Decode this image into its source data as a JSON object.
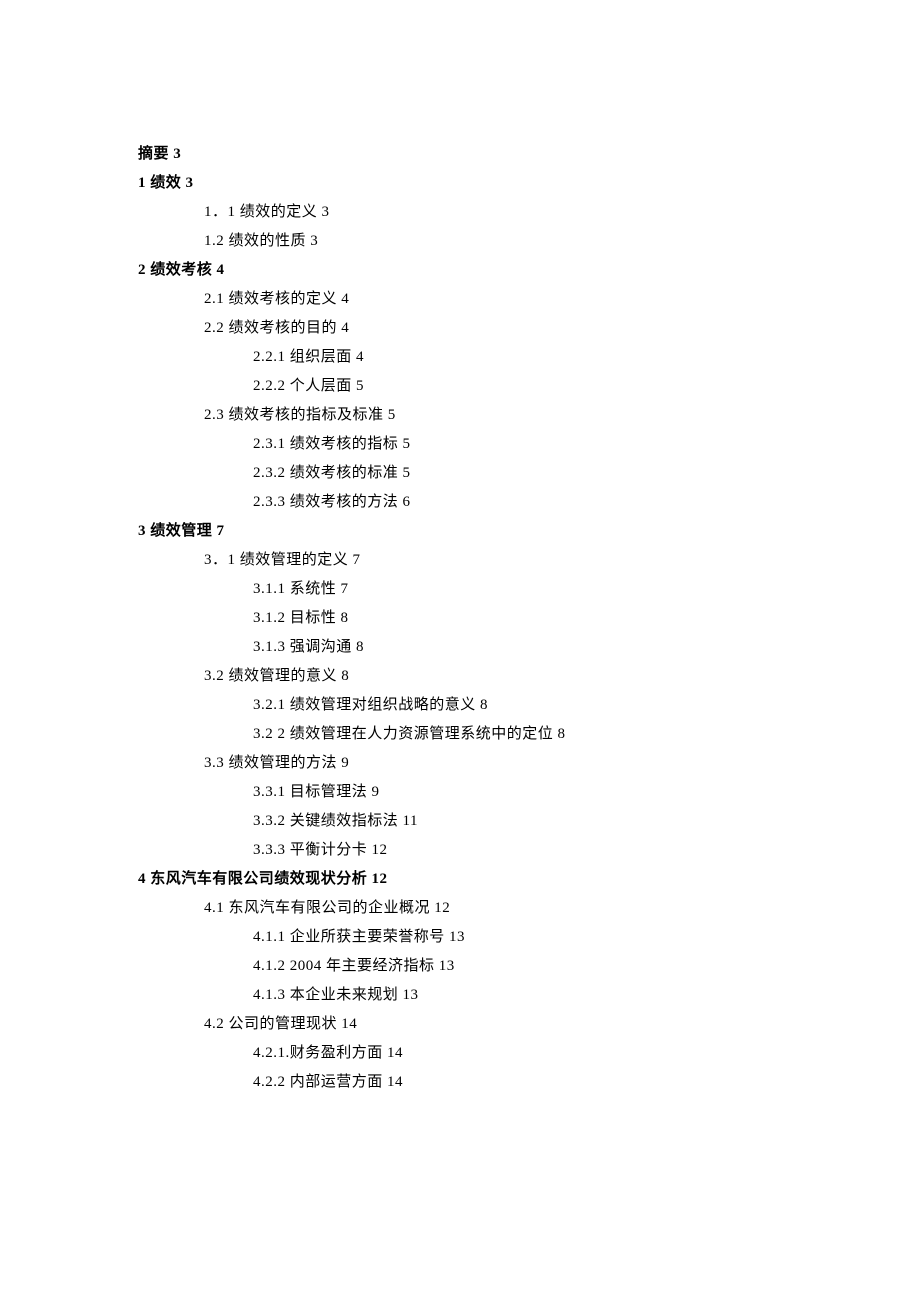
{
  "toc": [
    {
      "level": 0,
      "label": "摘要",
      "page": "3",
      "bold": true
    },
    {
      "level": 0,
      "label": "1 绩效",
      "page": "3",
      "bold": true
    },
    {
      "level": 1,
      "label": "1．1 绩效的定义",
      "page": "3"
    },
    {
      "level": 1,
      "label": "1.2 绩效的性质",
      "page": "3"
    },
    {
      "level": 0,
      "label": "2 绩效考核",
      "page": "4",
      "bold": true
    },
    {
      "level": 1,
      "label": "2.1 绩效考核的定义",
      "page": "4"
    },
    {
      "level": 1,
      "label": "2.2 绩效考核的目的",
      "page": "4"
    },
    {
      "level": 2,
      "label": "2.2.1 组织层面",
      "page": "4"
    },
    {
      "level": 2,
      "label": "2.2.2 个人层面",
      "page": "5"
    },
    {
      "level": 1,
      "label": "2.3 绩效考核的指标及标准",
      "page": "5"
    },
    {
      "level": 2,
      "label": "2.3.1 绩效考核的指标",
      "page": "5"
    },
    {
      "level": 2,
      "label": "2.3.2 绩效考核的标准",
      "page": "5"
    },
    {
      "level": 2,
      "label": "2.3.3 绩效考核的方法",
      "page": "6"
    },
    {
      "level": 0,
      "label": "3 绩效管理",
      "page": "7",
      "bold": true
    },
    {
      "level": 1,
      "label": "3．1 绩效管理的定义",
      "page": "7"
    },
    {
      "level": 2,
      "label": "3.1.1 系统性",
      "page": "7"
    },
    {
      "level": 2,
      "label": "3.1.2 目标性",
      "page": "8"
    },
    {
      "level": 2,
      "label": "3.1.3 强调沟通",
      "page": "8"
    },
    {
      "level": 1,
      "label": "3.2 绩效管理的意义",
      "page": "8"
    },
    {
      "level": 2,
      "label": "3.2.1 绩效管理对组织战略的意义",
      "page": "8"
    },
    {
      "level": 2,
      "label": "3.2 2 绩效管理在人力资源管理系统中的定位",
      "page": "8"
    },
    {
      "level": 1,
      "label": "3.3 绩效管理的方法",
      "page": "9"
    },
    {
      "level": 2,
      "label": "3.3.1 目标管理法",
      "page": "9"
    },
    {
      "level": 2,
      "label": "3.3.2 关键绩效指标法",
      "page": "11"
    },
    {
      "level": 2,
      "label": "3.3.3 平衡计分卡",
      "page": "12"
    },
    {
      "level": 0,
      "label": "4 东风汽车有限公司绩效现状分析",
      "page": "12",
      "bold": true
    },
    {
      "level": 1,
      "label": "4.1 东风汽车有限公司的企业概况",
      "page": "12"
    },
    {
      "level": 2,
      "label": "4.1.1 企业所获主要荣誉称号",
      "page": "13"
    },
    {
      "level": 2,
      "label": "4.1.2 2004 年主要经济指标",
      "page": "13"
    },
    {
      "level": 2,
      "label": "4.1.3 本企业未来规划",
      "page": "13"
    },
    {
      "level": 1,
      "label": "4.2 公司的管理现状",
      "page": "14"
    },
    {
      "level": 2,
      "label": "4.2.1.财务盈利方面",
      "page": "14"
    },
    {
      "level": 2,
      "label": "4.2.2 内部运营方面",
      "page": "14"
    }
  ]
}
